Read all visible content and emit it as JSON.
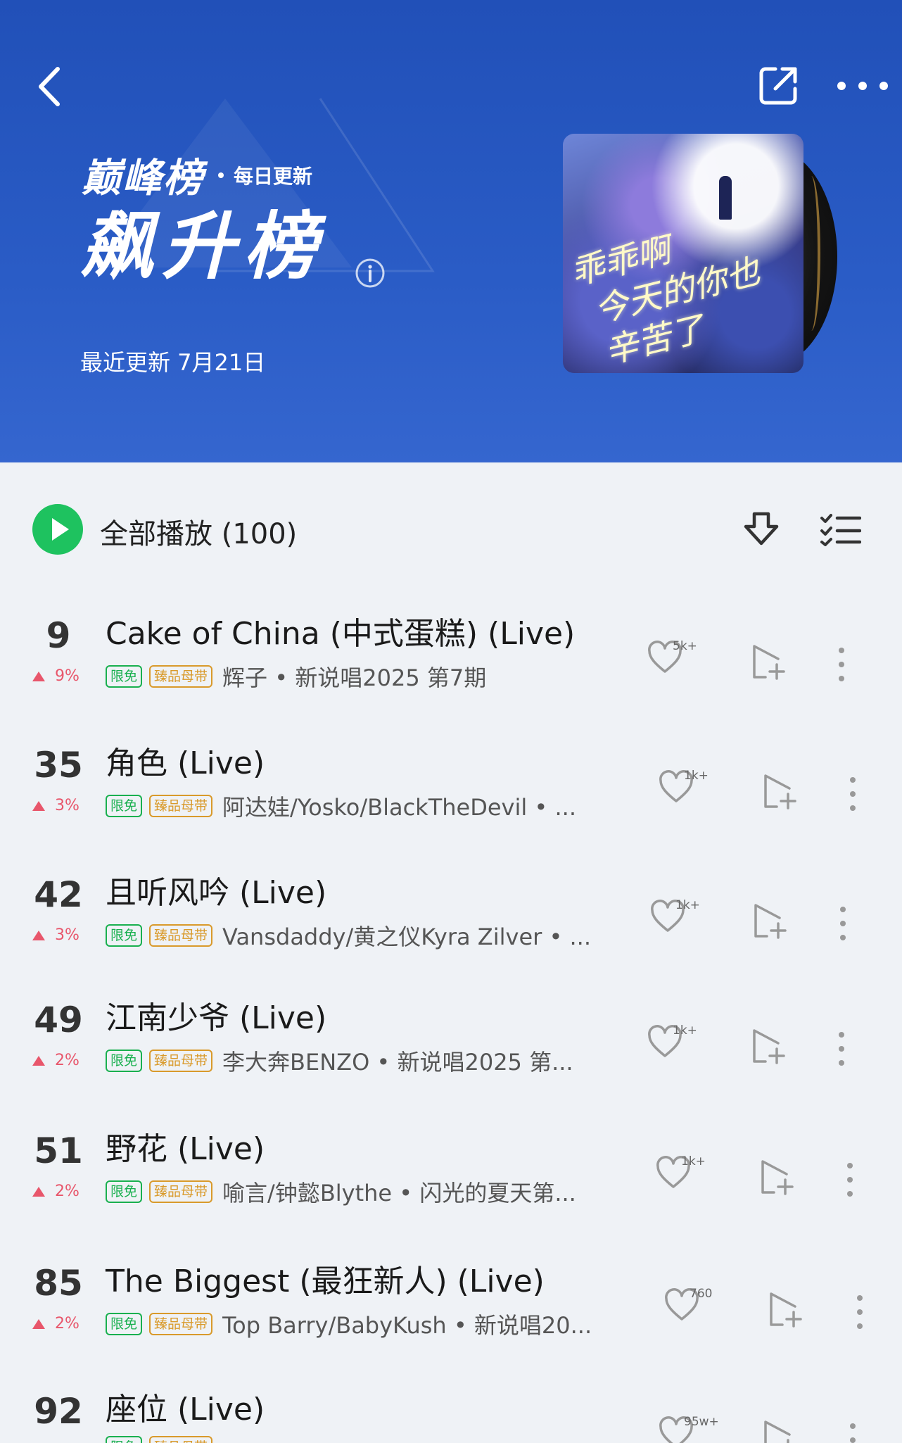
{
  "header": {
    "brand_name": "巅峰榜",
    "brand_sub": "每日更新",
    "chart_title": "飙升榜",
    "update_text": "最近更新 7月21日",
    "cover_text_line1": "乖乖啊",
    "cover_text_line2": "今天的你也",
    "cover_text_line3": "辛苦了"
  },
  "toolbar": {
    "play_all_label": "全部播放 (100)"
  },
  "tags": {
    "free": "限免",
    "master": "臻品母带"
  },
  "songs": [
    {
      "rank": "9",
      "delta": "9%",
      "title": "Cake of China (中式蛋糕) (Live)",
      "artist": "辉子 • 新说唱2025 第7期",
      "likes": "5k+"
    },
    {
      "rank": "35",
      "delta": "3%",
      "title": "角色 (Live)",
      "artist": "阿达娃/Yosko/BlackTheDevil • ...",
      "likes": "1k+"
    },
    {
      "rank": "42",
      "delta": "3%",
      "title": "且听风吟 (Live)",
      "artist": "Vansdaddy/黄之仪Kyra Zilver • ...",
      "likes": "1k+"
    },
    {
      "rank": "49",
      "delta": "2%",
      "title": "江南少爷 (Live)",
      "artist": "李大奔BENZO • 新说唱2025 第...",
      "likes": "1k+"
    },
    {
      "rank": "51",
      "delta": "2%",
      "title": "野花 (Live)",
      "artist": "喻言/钟懿Blythe • 闪光的夏天第...",
      "likes": "1k+"
    },
    {
      "rank": "85",
      "delta": "2%",
      "title": "The Biggest (最狂新人) (Live)",
      "artist": "Top Barry/BabyKush • 新说唱20...",
      "likes": "760"
    },
    {
      "rank": "92",
      "delta": "",
      "title": "座位 (Live)",
      "artist": "",
      "likes": "95w+"
    }
  ],
  "colors": {
    "header_blue": "#2a5cc6",
    "play_green": "#1ec25f",
    "rise_red": "#e8566b",
    "tag_free_green": "#19b04f",
    "tag_master_gold": "#d99a2b"
  },
  "icons": [
    "back-icon",
    "share-icon",
    "more-icon",
    "info-icon",
    "play-icon",
    "download-icon",
    "multi-select-icon",
    "heart-icon",
    "add-to-playlist-icon",
    "vertical-more-icon"
  ]
}
